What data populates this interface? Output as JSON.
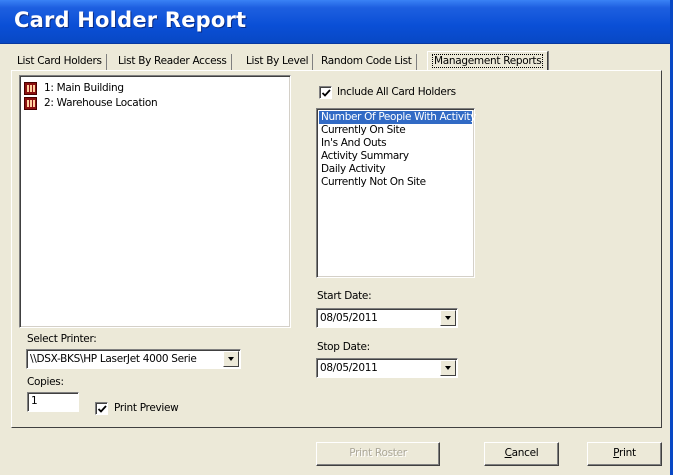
{
  "window": {
    "title": "Card Holder Report"
  },
  "tabs": [
    {
      "label": "List Card Holders"
    },
    {
      "label": "List By Reader Access"
    },
    {
      "label": "List By Level"
    },
    {
      "label": "Random Code List"
    },
    {
      "label": "Management Reports",
      "active": true
    }
  ],
  "tree": {
    "items": [
      {
        "label": "1: Main Building",
        "icon": "building-icon"
      },
      {
        "label": "2: Warehouse Location",
        "icon": "building-icon"
      }
    ]
  },
  "printer": {
    "label": "Select Printer:",
    "value": "\\\\DSX-BKS\\HP LaserJet 4000 Serie"
  },
  "copies": {
    "label": "Copies:",
    "value": "1"
  },
  "print_preview": {
    "label": "Print Preview",
    "checked": true
  },
  "include_all": {
    "label": "Include All Card Holders",
    "checked": true
  },
  "reports": {
    "items": [
      "Number Of People With Activity",
      "Currently On Site",
      "In's And Outs",
      "Activity Summary",
      "Daily Activity",
      "Currently Not On Site"
    ],
    "selected_index": 0
  },
  "start_date": {
    "label": "Start Date:",
    "value": "08/05/2011"
  },
  "stop_date": {
    "label": "Stop Date:",
    "value": "08/05/2011"
  },
  "buttons": {
    "print_roster": "Print Roster",
    "cancel_first": "C",
    "cancel_rest": "ancel",
    "print_first": "P",
    "print_rest": "rint"
  },
  "colors": {
    "title_bar": "#0a4fd6",
    "selection": "#316ac5",
    "face": "#ece9d8"
  }
}
